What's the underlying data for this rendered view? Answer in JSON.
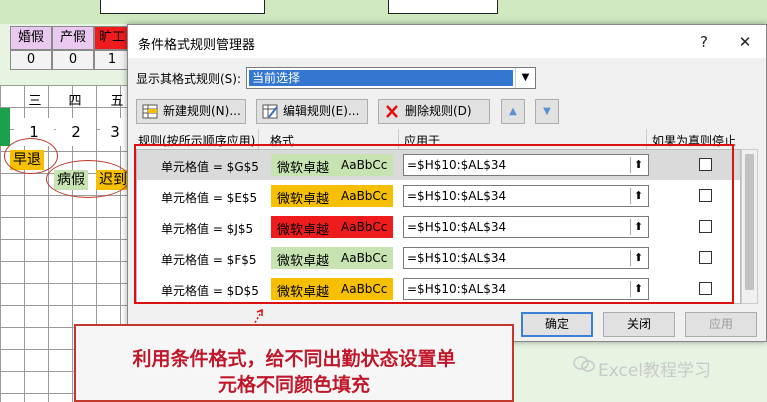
{
  "spreadsheet": {
    "leave_headers": [
      {
        "label": "婚假",
        "count": "0"
      },
      {
        "label": "产假",
        "count": "0"
      },
      {
        "label": "旷工",
        "count": "1"
      }
    ],
    "weekday_headers": [
      "三",
      "四",
      "五"
    ],
    "day_numbers": [
      "1",
      "2",
      "3"
    ],
    "status_tags": [
      {
        "label": "早退",
        "color": "#f6c000"
      },
      {
        "label": "病假",
        "color": "#c7e3b1"
      },
      {
        "label": "迟到",
        "color": "#f6c000"
      }
    ]
  },
  "dialog": {
    "title": "条件格式规则管理器",
    "help_label": "?",
    "close_label": "✕",
    "show_rules_label": "显示其格式规则(S):",
    "show_rules_value": "当前选择",
    "toolbar": {
      "new_rule": "新建规则(N)...",
      "edit_rule": "编辑规则(E)...",
      "delete_rule": "删除规则(D)"
    },
    "columns": {
      "rule": "规则(按所示顺序应用)",
      "format": "格式",
      "applies_to": "应用于",
      "stop_if_true": "如果为真则停止"
    },
    "rules": [
      {
        "rule": "单元格值 = $G$5",
        "preview_zh": "微软卓越",
        "preview_latin": "AaBbCc",
        "fill": "#c7e3b1",
        "applies_to": "=$H$10:$AL$34",
        "stop_if_true": false,
        "selected": true
      },
      {
        "rule": "单元格值 = $E$5",
        "preview_zh": "微软卓越",
        "preview_latin": "AaBbCc",
        "fill": "#f6c000",
        "applies_to": "=$H$10:$AL$34",
        "stop_if_true": false,
        "selected": false
      },
      {
        "rule": "单元格值 = $J$5",
        "preview_zh": "微软卓越",
        "preview_latin": "AaBbCc",
        "fill": "#ee1c1c",
        "applies_to": "=$H$10:$AL$34",
        "stop_if_true": false,
        "selected": false
      },
      {
        "rule": "单元格值 = $F$5",
        "preview_zh": "微软卓越",
        "preview_latin": "AaBbCc",
        "fill": "#c7e3b1",
        "applies_to": "=$H$10:$AL$34",
        "stop_if_true": false,
        "selected": false
      },
      {
        "rule": "单元格值 = $D$5",
        "preview_zh": "微软卓越",
        "preview_latin": "AaBbCc",
        "fill": "#f6c000",
        "applies_to": "=$H$10:$AL$34",
        "stop_if_true": false,
        "selected": false
      }
    ],
    "buttons": {
      "ok": "确定",
      "close": "关闭",
      "apply": "应用"
    }
  },
  "annotation": {
    "line1": "利用条件格式，给不同出勤状态设置单",
    "line2": "元格不同颜色填充"
  },
  "watermark": "Excel教程学习"
}
